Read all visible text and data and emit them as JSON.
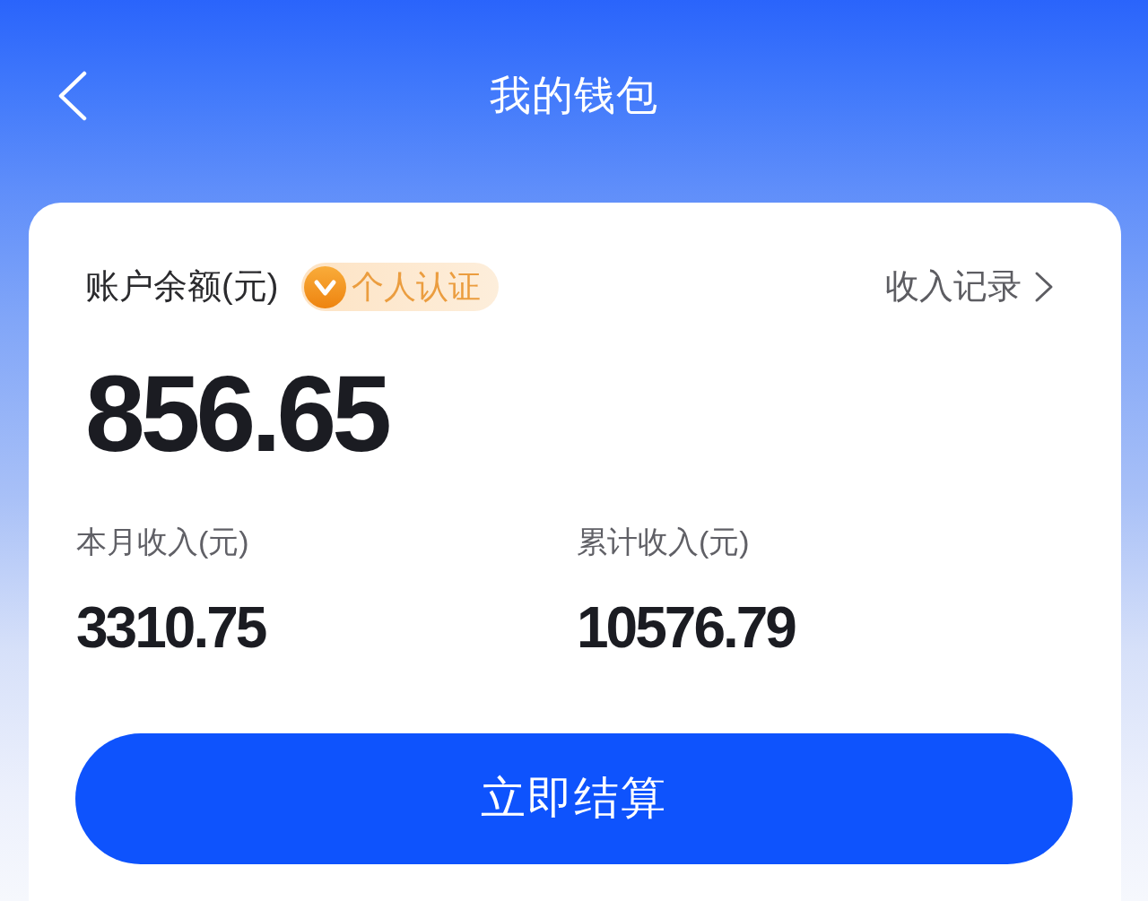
{
  "header": {
    "title": "我的钱包"
  },
  "balance": {
    "label": "账户余额(元)",
    "badge": "个人认证",
    "records_link": "收入记录",
    "amount": "856.65"
  },
  "stats": [
    {
      "label": "本月收入(元)",
      "value": "3310.75"
    },
    {
      "label": "累计收入(元)",
      "value": "10576.79"
    }
  ],
  "settle_button": "立即结算"
}
